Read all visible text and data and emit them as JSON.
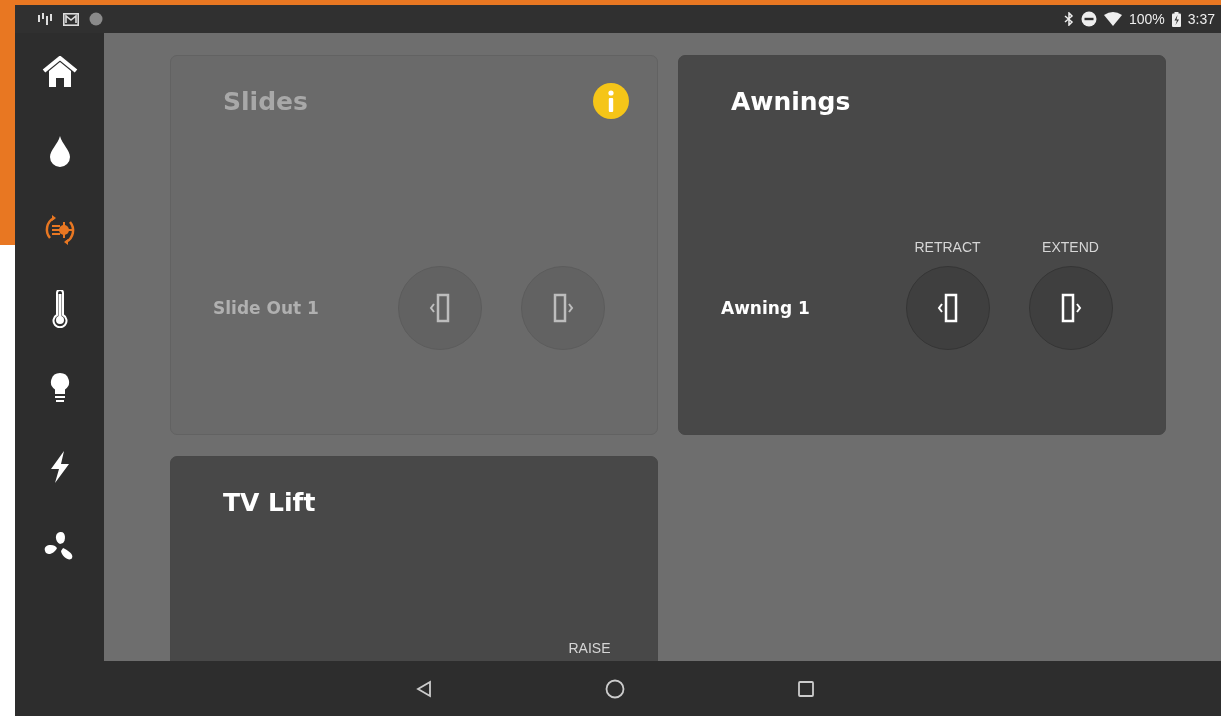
{
  "status_bar": {
    "battery": "100%",
    "time": "3:37"
  },
  "sidebar": {
    "items": [
      {
        "kind": "home",
        "selected": false
      },
      {
        "kind": "water",
        "selected": false
      },
      {
        "kind": "slides",
        "selected": true
      },
      {
        "kind": "temperature",
        "selected": false
      },
      {
        "kind": "light",
        "selected": false
      },
      {
        "kind": "power",
        "selected": false
      },
      {
        "kind": "fan",
        "selected": false
      }
    ]
  },
  "cards": [
    {
      "title": "Slides",
      "disabled": true,
      "info_badge": true,
      "rows": [
        {
          "name": "Slide Out 1",
          "controls": [
            {
              "kind": "retract"
            },
            {
              "kind": "extend"
            }
          ]
        }
      ]
    },
    {
      "title": "Awnings",
      "disabled": false,
      "info_badge": false,
      "rows": [
        {
          "name": "Awning 1",
          "controls": [
            {
              "kind": "retract",
              "label": "RETRACT"
            },
            {
              "kind": "extend",
              "label": "EXTEND"
            }
          ]
        }
      ]
    },
    {
      "title": "TV Lift",
      "disabled": false,
      "info_badge": false,
      "rows": [
        {
          "controls": [
            {
              "label": "RAISE"
            }
          ]
        }
      ]
    }
  ]
}
